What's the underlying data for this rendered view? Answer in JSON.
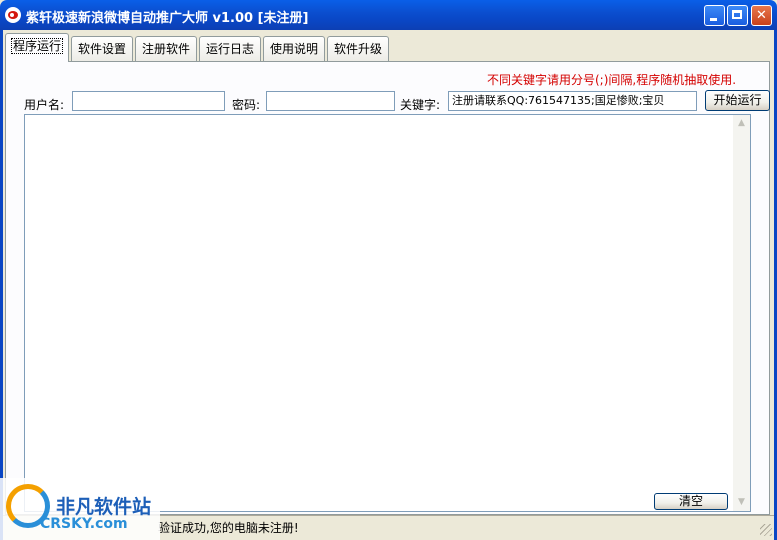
{
  "window": {
    "title": "紫轩极速新浪微博自动推广大师   v1.00 [未注册]",
    "minimize_icon": "minimize-icon",
    "maximize_icon": "maximize-icon",
    "close_icon": "close-icon",
    "close_glyph": "✕"
  },
  "tabs": [
    {
      "label": "程序运行",
      "active": true
    },
    {
      "label": "软件设置",
      "active": false
    },
    {
      "label": "注册软件",
      "active": false
    },
    {
      "label": "运行日志",
      "active": false
    },
    {
      "label": "使用说明",
      "active": false
    },
    {
      "label": "软件升级",
      "active": false
    }
  ],
  "form": {
    "hint": "不同关键字请用分号(;)间隔,程序随机抽取使用.",
    "username_label": "用户名:",
    "username_value": "",
    "password_label": "密码:",
    "password_value": "",
    "keyword_label": "关键字:",
    "keyword_value": "注册请联系QQ:761547135;国足惨败;宝贝",
    "start_button": "开始运行"
  },
  "log": {
    "content": "",
    "clear_button": "清空",
    "scroll_up_glyph": "▲",
    "scroll_down_glyph": "▼"
  },
  "status": {
    "text": "验证成功,您的电脑未注册!"
  },
  "watermark": {
    "cn": "非凡软件站",
    "en": "CRSKY.com"
  },
  "colors": {
    "titlebar": "#0a46c4",
    "hint": "#d40000",
    "face": "#ece9d8"
  }
}
